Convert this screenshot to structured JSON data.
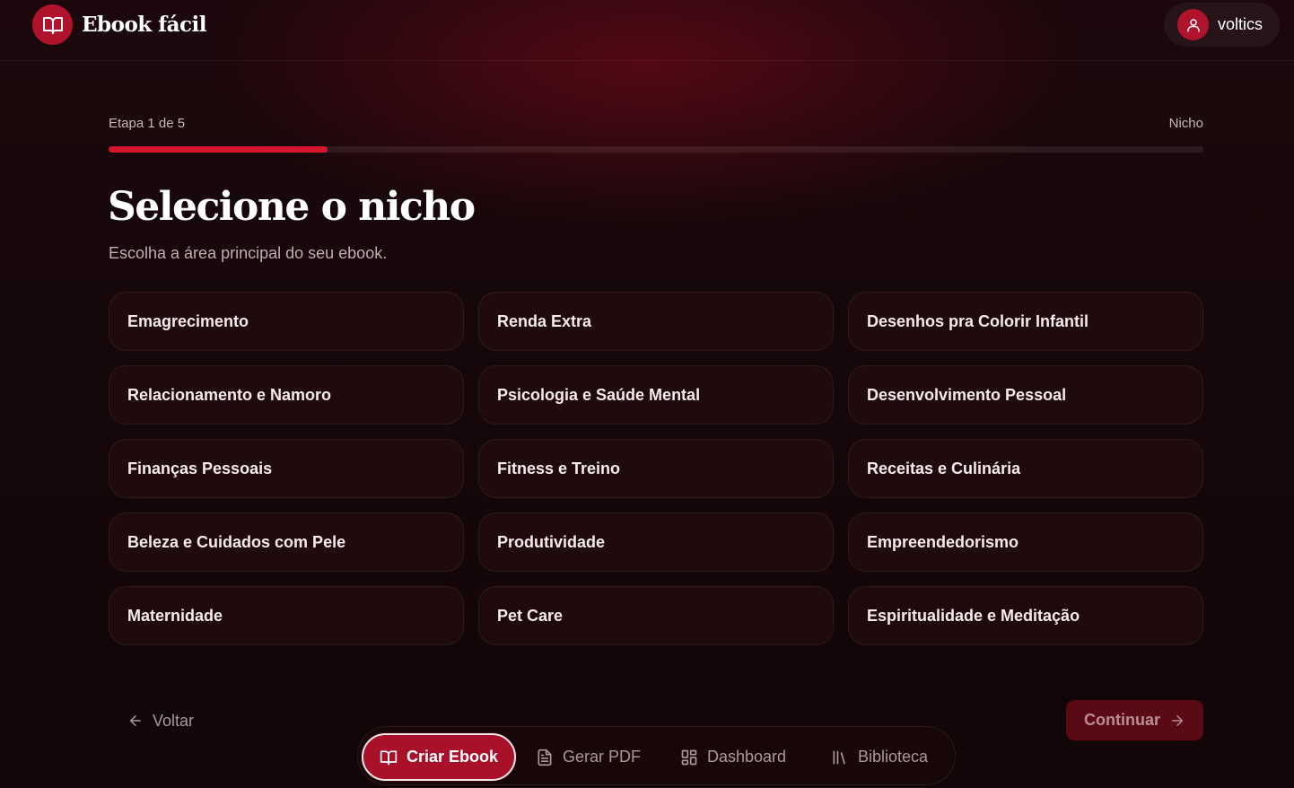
{
  "header": {
    "brand_name": "Ebook fácil",
    "brand_icon": "book-open-icon",
    "user_name": "voltics",
    "user_icon": "user-icon"
  },
  "progress": {
    "step_label": "Etapa 1 de 5",
    "step_name": "Nicho",
    "fraction": 0.2
  },
  "page": {
    "title": "Selecione o nicho",
    "subtitle": "Escolha a área principal do seu ebook."
  },
  "niches": [
    "Emagrecimento",
    "Renda Extra",
    "Desenhos pra Colorir Infantil",
    "Relacionamento e Namoro",
    "Psicologia e Saúde Mental",
    "Desenvolvimento Pessoal",
    "Finanças Pessoais",
    "Fitness e Treino",
    "Receitas e Culinária",
    "Beleza e Cuidados com Pele",
    "Produtividade",
    "Empreendedorismo",
    "Maternidade",
    "Pet Care",
    "Espiritualidade e Meditação"
  ],
  "actions": {
    "back_label": "Voltar",
    "continue_label": "Continuar"
  },
  "nav": {
    "create_label": "Criar Ebook",
    "pdf_label": "Gerar PDF",
    "dashboard_label": "Dashboard",
    "library_label": "Biblioteca"
  },
  "colors": {
    "accent": "#b0142c",
    "progress": "#d6152f",
    "background": "#16070a"
  }
}
